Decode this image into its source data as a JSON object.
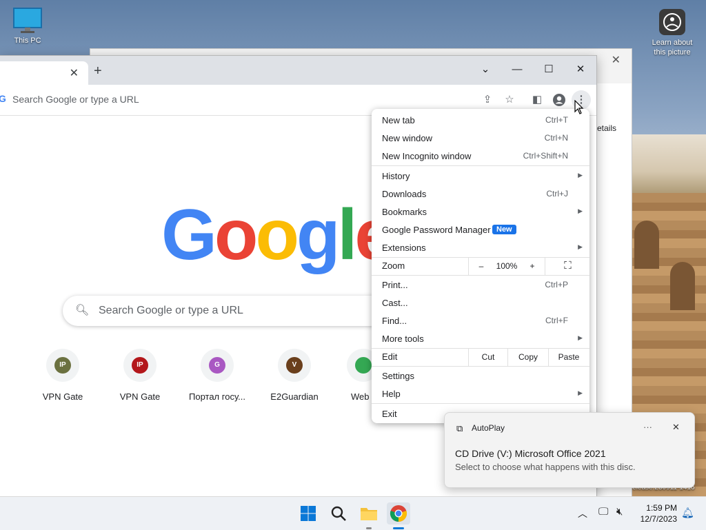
{
  "desktop": {
    "this_pc_label": "This PC",
    "learn_label": "Learn about this picture",
    "corner_text": "947.rs_prerelease.230911-1416"
  },
  "browser": {
    "omnibox_placeholder": "Search Google or type a URL",
    "search_placeholder": "Search Google or type a URL",
    "logo_letters": [
      "G",
      "o",
      "o",
      "g",
      "l",
      "e"
    ],
    "logo_colors": [
      "#4285f4",
      "#ea4335",
      "#fbbc05",
      "#4285f4",
      "#34a853",
      "#ea4335"
    ],
    "shortcuts": [
      {
        "label": "VPN Gate",
        "letter": "IP",
        "color": "#6b7140"
      },
      {
        "label": "VPN Gate",
        "letter": "IP",
        "color": "#b3171b"
      },
      {
        "label": "Портал госу...",
        "letter": "G",
        "color": "#a958c2"
      },
      {
        "label": "E2Guardian",
        "letter": "V",
        "color": "#6a3f1c"
      },
      {
        "label": "Web",
        "letter": "",
        "color": "#34a853"
      }
    ]
  },
  "bg_window": {
    "partial_text": "etails"
  },
  "menu": {
    "new_tab": {
      "label": "New tab",
      "shortcut": "Ctrl+T"
    },
    "new_window": {
      "label": "New window",
      "shortcut": "Ctrl+N"
    },
    "new_incognito": {
      "label": "New Incognito window",
      "shortcut": "Ctrl+Shift+N"
    },
    "history": {
      "label": "History"
    },
    "downloads": {
      "label": "Downloads",
      "shortcut": "Ctrl+J"
    },
    "bookmarks": {
      "label": "Bookmarks"
    },
    "password_manager": {
      "label": "Google Password Manager",
      "badge": "New"
    },
    "extensions": {
      "label": "Extensions"
    },
    "zoom": {
      "label": "Zoom",
      "minus": "–",
      "value": "100%",
      "plus": "+"
    },
    "print": {
      "label": "Print...",
      "shortcut": "Ctrl+P"
    },
    "cast": {
      "label": "Cast..."
    },
    "find": {
      "label": "Find...",
      "shortcut": "Ctrl+F"
    },
    "more_tools": {
      "label": "More tools"
    },
    "edit": {
      "label": "Edit",
      "cut": "Cut",
      "copy": "Copy",
      "paste": "Paste"
    },
    "settings": {
      "label": "Settings"
    },
    "help": {
      "label": "Help"
    },
    "exit": {
      "label": "Exit"
    }
  },
  "toast": {
    "app": "AutoPlay",
    "more": "···",
    "title": "CD Drive (V:) Microsoft Office 2021",
    "body": "Select to choose what happens with this disc."
  },
  "taskbar": {
    "time": "1:59 PM",
    "date": "12/7/2023"
  }
}
